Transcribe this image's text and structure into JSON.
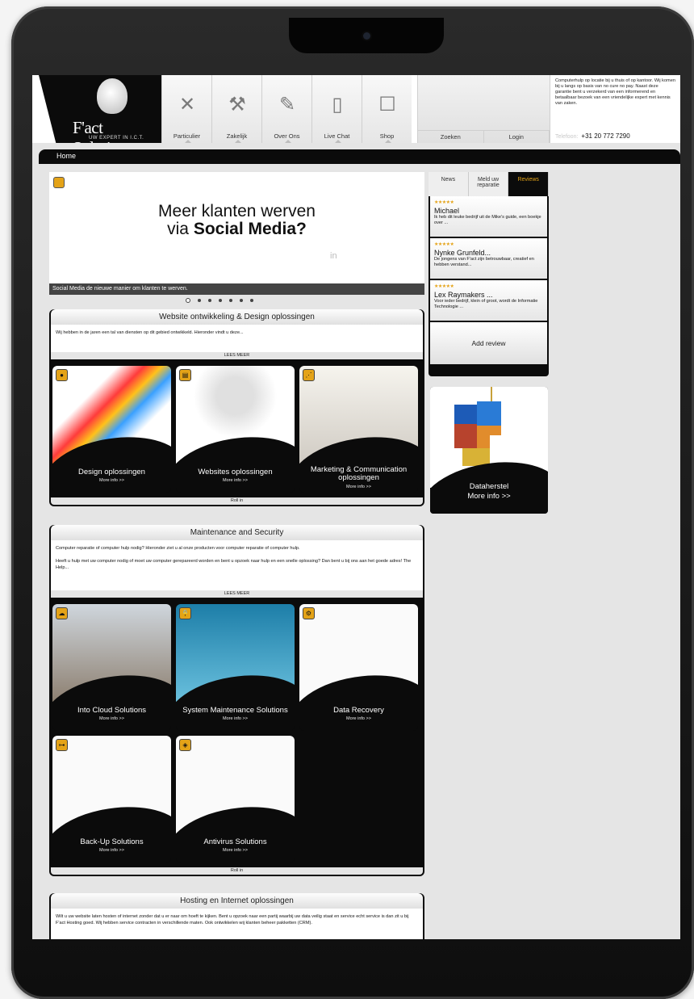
{
  "header": {
    "logo_text": "F'act Solutions",
    "logo_sub": "UW EXPERT IN I.C.T.",
    "nav": [
      {
        "label": "Particulier",
        "icon": "tools-icon"
      },
      {
        "label": "Zakelijk",
        "icon": "screwdriver-icon"
      },
      {
        "label": "Over Ons",
        "icon": "pen-paper-icon"
      },
      {
        "label": "Live Chat",
        "icon": "chat-panel-icon"
      },
      {
        "label": "Shop",
        "icon": "shop-icon"
      }
    ],
    "search_tab": "Zoeken",
    "login_tab": "Login",
    "info_text": "Computerhulp op locatie bij u thuis of op kantoor. Wij komen bij u langs op basis van no cure no pay. Naast deze garantie bent u verzekerd van een informerend en betaalbaar bezoek van een vriendelijke expert met kennis van zaken.",
    "phone_label": "Telefoon:",
    "phone": "+31 20 772 7290"
  },
  "breadcrumb": "Home",
  "slider": {
    "headline_1": "Meer klanten werven",
    "headline_2a": "via ",
    "headline_2b": "Social Media?",
    "caption": "Social Media de nieuwe manier om klanten te werven.",
    "dots": 7
  },
  "section1": {
    "title": "Website ontwikkeling & Design oplossingen",
    "body": "Wij hebben in de jaren een tal van diensten op dit gebied ontwikkeld. Hieronder vindt u deze...",
    "lees": "LEES MEER",
    "cards": [
      {
        "title": "Design oplossingen",
        "more": "More info >>"
      },
      {
        "title": "Websites oplossingen",
        "more": "More info >>"
      },
      {
        "title": "Marketing & Communication oplossingen",
        "more": "More info >>"
      }
    ],
    "roll": "Roll in"
  },
  "section2": {
    "title": "Maintenance and Security",
    "body1": "Computer reparatie of computer hulp nodig? Hieronder ziet u al onze producten voor computer reparatie of computer hulp.",
    "body2": "Heeft u hulp met uw computer nodig of moet uw computer gerepareerd worden en bent u opzoek naar hulp en een snelle oplossing? Dan bent u bij ons aan het goede adres! The Help...",
    "lees": "LEES MEER",
    "cards": [
      {
        "title": "Into Cloud Solutions",
        "more": "More info >>"
      },
      {
        "title": "System Maintenance Solutions",
        "more": "More info >>"
      },
      {
        "title": "Data Recovery",
        "more": "More info >>"
      },
      {
        "title": "Back-Up Solutions",
        "more": "More info >>"
      },
      {
        "title": "Antivirus Solutions",
        "more": "More info >>"
      }
    ],
    "roll": "Roll in"
  },
  "section3": {
    "title": "Hosting en Internet oplossingen",
    "body": "Wilt u uw website laten hosten of internet zonder dat u er naar om hoeft te kijken. Bent u opzoek naar een partij waarbij uw data veilig staat en service echt service is dan zit u bij F'act Hosting goed. Wij hebben service contracten in verschillende maten. Ook ontwikkelen wij klanten beheer pakketten (CRM)."
  },
  "reviews": {
    "tabs": [
      "News",
      "Meld uw reparatie",
      "Reviews"
    ],
    "items": [
      {
        "stars": "★★★★★",
        "name": "Michael",
        "text": "Ik heb dit leuke bedrijf uit de Mike's guide, een boekje over ..."
      },
      {
        "stars": "★★★★★",
        "name": "Nynke Grunfeld...",
        "text": "De jongens van F'act zijn betrouwbaar, creatief en hebben verstand..."
      },
      {
        "stars": "★★★★★",
        "name": "Lex Raymakers ...",
        "text": "Voor ieder bedrijf, klein of groot, wordt de Informatie Technologie ..."
      }
    ],
    "add": "Add review"
  },
  "promo": {
    "title": "Dataherstel",
    "more": "More info >>"
  }
}
